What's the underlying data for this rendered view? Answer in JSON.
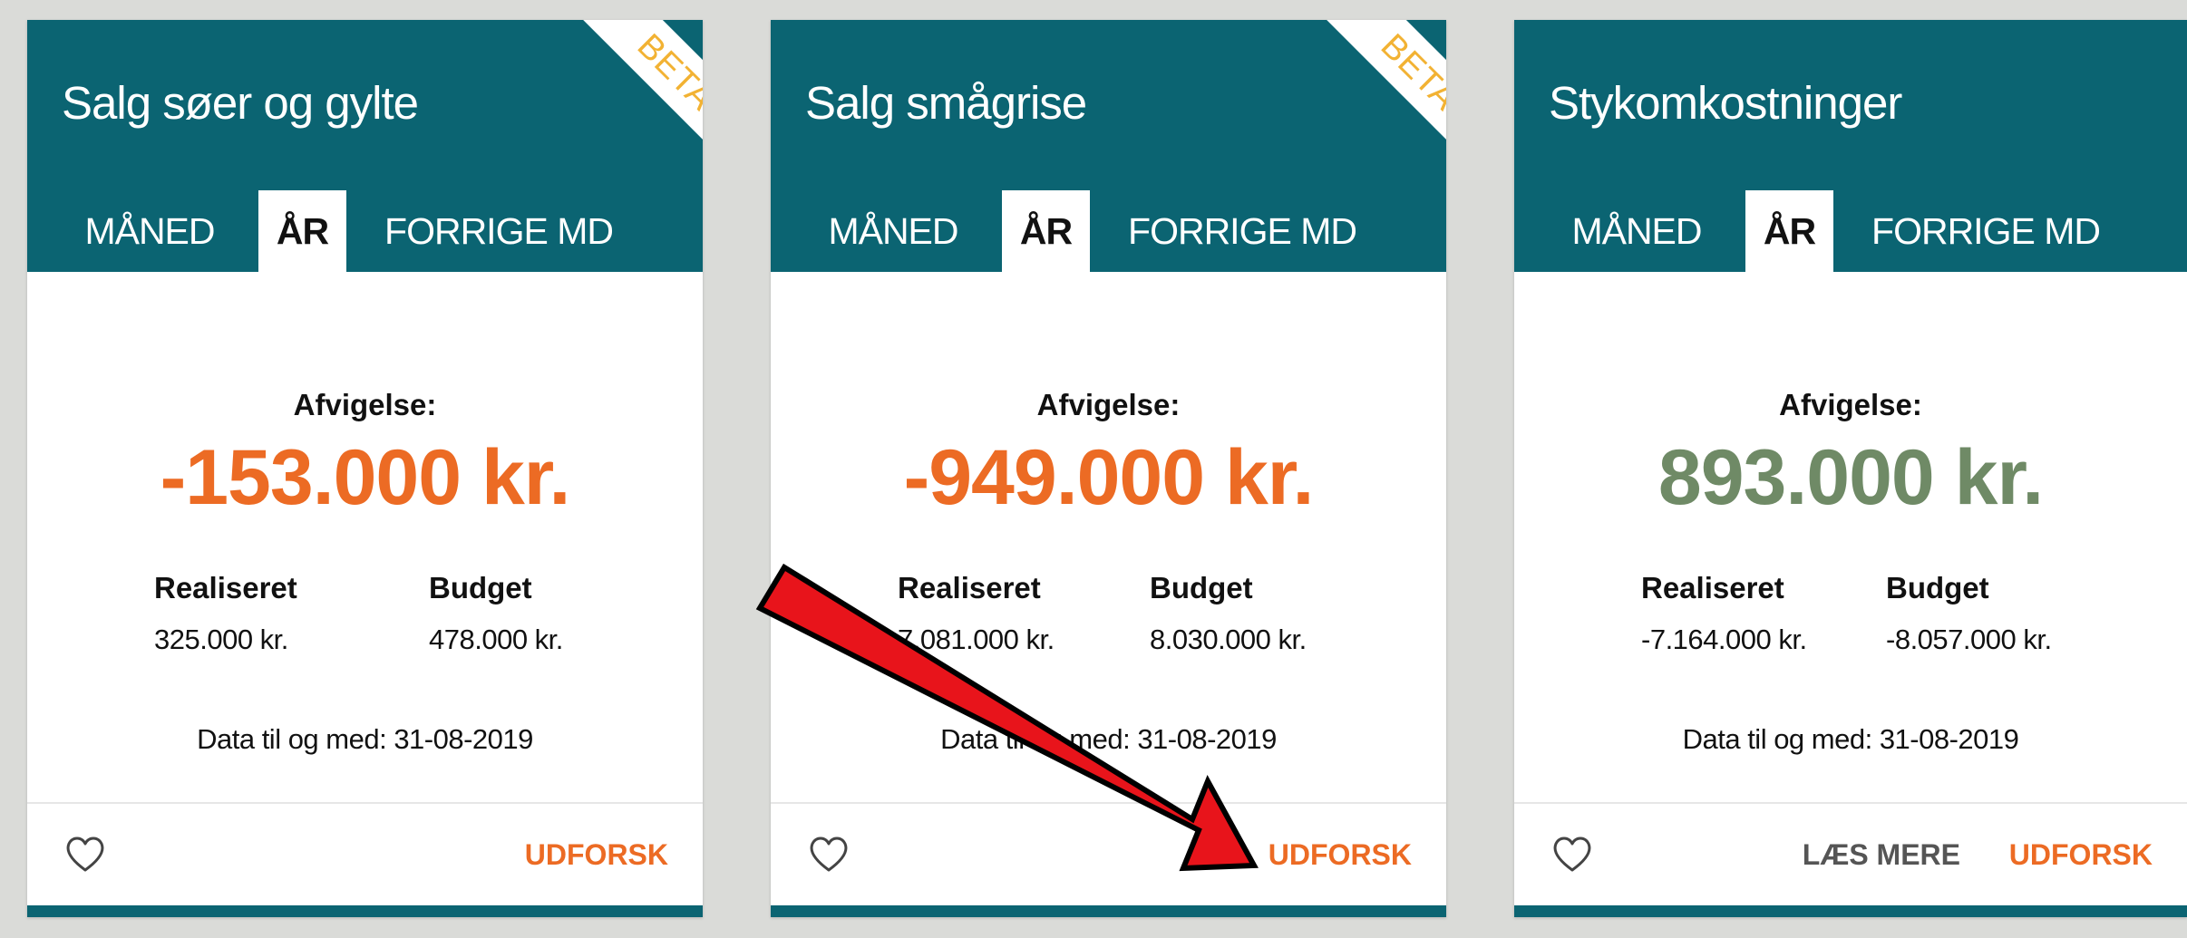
{
  "tabs": {
    "month": "MÅNED",
    "year": "ÅR",
    "prev_month": "FORRIGE MD"
  },
  "badge": "BETA",
  "labels": {
    "deviation": "Afvigelse:",
    "realized": "Realiseret",
    "budget": "Budget"
  },
  "actions": {
    "explore": "UDFORSK",
    "read_more": "LÆS MERE"
  },
  "cards": [
    {
      "title": "Salg søer og gylte",
      "deviation": "-153.000 kr.",
      "realized": "325.000 kr.",
      "budget": "478.000 kr.",
      "data_until": "Data til og med: 31-08-2019"
    },
    {
      "title": "Salg smågrise",
      "deviation": "-949.000 kr.",
      "realized": "7.081.000 kr.",
      "budget": "8.030.000 kr.",
      "data_until": "Data til og med: 31-08-2019"
    },
    {
      "title": "Stykomkostninger",
      "deviation": "893.000 kr.",
      "realized": "-7.164.000 kr.",
      "budget": "-8.057.000 kr.",
      "data_until": "Data til og med: 31-08-2019"
    }
  ],
  "colors": {
    "header": "#0b6472",
    "negative": "#ec6b24",
    "positive": "#6f8a66",
    "badge": "#f2b233",
    "arrow": "#e8141b",
    "background": "#dadbd8"
  },
  "icons": {
    "favorite": "heart-outline-icon",
    "annotation": "red-arrow"
  }
}
